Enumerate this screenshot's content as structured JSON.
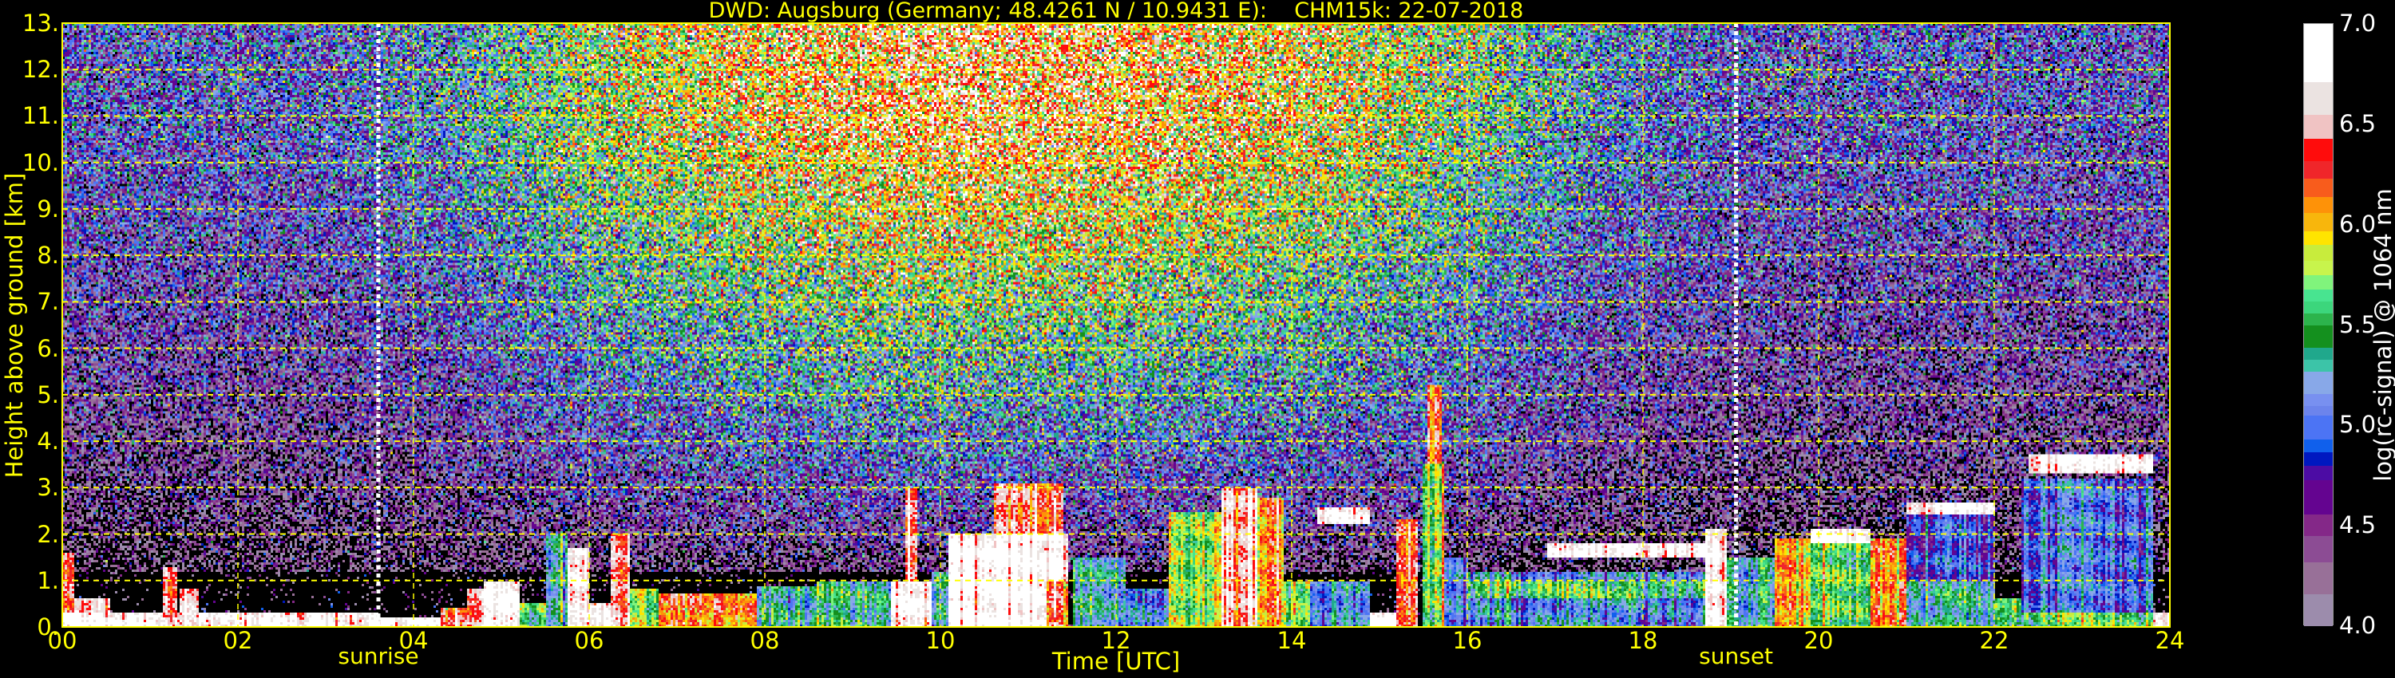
{
  "chart_data": {
    "type": "heatmap",
    "title": "DWD: Augsburg (Germany; 48.4261 N / 10.9431 E):    CHM15k: 22-07-2018",
    "xlabel": "Time [UTC]",
    "ylabel": "Height above ground [km]",
    "colorbar_label": "log(rc-signal) @ 1064 nm",
    "xlim": [
      0,
      24
    ],
    "ylim": [
      0,
      13
    ],
    "x_ticks": [
      "00",
      "02",
      "04",
      "06",
      "08",
      "10",
      "12",
      "14",
      "16",
      "18",
      "20",
      "22",
      "24"
    ],
    "x_tick_values": [
      0,
      2,
      4,
      6,
      8,
      10,
      12,
      14,
      16,
      18,
      20,
      22,
      24
    ],
    "y_ticks": [
      "0.",
      "1.",
      "2.",
      "3.",
      "4.",
      "5.",
      "6.",
      "7.",
      "8.",
      "9.",
      "10.",
      "11.",
      "12.",
      "13."
    ],
    "y_tick_values": [
      0,
      1,
      2,
      3,
      4,
      5,
      6,
      7,
      8,
      9,
      10,
      11,
      12,
      13
    ],
    "grid": true,
    "grid_color": "#ffff00",
    "clim": [
      4.0,
      7.0
    ],
    "colorbar_ticks": [
      "4.0",
      "4.5",
      "5.0",
      "5.5",
      "6.0",
      "6.5",
      "7.0"
    ],
    "colorbar_tick_values": [
      4.0,
      4.5,
      5.0,
      5.5,
      6.0,
      6.5,
      7.0
    ],
    "colormap": [
      {
        "from": 4.0,
        "to": 4.16,
        "color": "#9c8cac"
      },
      {
        "from": 4.16,
        "to": 4.32,
        "color": "#987098"
      },
      {
        "from": 4.32,
        "to": 4.45,
        "color": "#8c4c94"
      },
      {
        "from": 4.45,
        "to": 4.56,
        "color": "#842888"
      },
      {
        "from": 4.56,
        "to": 4.73,
        "color": "#640490"
      },
      {
        "from": 4.73,
        "to": 4.8,
        "color": "#4c0ca4"
      },
      {
        "from": 4.8,
        "to": 4.87,
        "color": "#0018c0"
      },
      {
        "from": 4.87,
        "to": 4.93,
        "color": "#1060ec"
      },
      {
        "from": 4.93,
        "to": 5.05,
        "color": "#4c74f4"
      },
      {
        "from": 5.05,
        "to": 5.1,
        "color": "#6c84ec"
      },
      {
        "from": 5.1,
        "to": 5.16,
        "color": "#7890f0"
      },
      {
        "from": 5.16,
        "to": 5.27,
        "color": "#88a8e8"
      },
      {
        "from": 5.27,
        "to": 5.33,
        "color": "#3cc4a8"
      },
      {
        "from": 5.33,
        "to": 5.39,
        "color": "#20a88c"
      },
      {
        "from": 5.39,
        "to": 5.5,
        "color": "#14901e"
      },
      {
        "from": 5.5,
        "to": 5.56,
        "color": "#2cb44c"
      },
      {
        "from": 5.56,
        "to": 5.62,
        "color": "#3cd67c"
      },
      {
        "from": 5.62,
        "to": 5.68,
        "color": "#48e490"
      },
      {
        "from": 5.68,
        "to": 5.75,
        "color": "#80f47c"
      },
      {
        "from": 5.75,
        "to": 5.82,
        "color": "#c8f44c"
      },
      {
        "from": 5.82,
        "to": 5.9,
        "color": "#c8ec3c"
      },
      {
        "from": 5.9,
        "to": 5.97,
        "color": "#ffe400"
      },
      {
        "from": 5.97,
        "to": 6.06,
        "color": "#f8b60c"
      },
      {
        "from": 6.06,
        "to": 6.14,
        "color": "#fe9208"
      },
      {
        "from": 6.14,
        "to": 6.23,
        "color": "#f85c1c"
      },
      {
        "from": 6.23,
        "to": 6.32,
        "color": "#f0262a"
      },
      {
        "from": 6.32,
        "to": 6.43,
        "color": "#ff0c0c"
      },
      {
        "from": 6.43,
        "to": 6.55,
        "color": "#f0c3c3"
      },
      {
        "from": 6.55,
        "to": 6.71,
        "color": "#ebe3e1"
      },
      {
        "from": 6.71,
        "to": 7.0,
        "color": "#ffffff"
      }
    ],
    "markers": [
      {
        "label": "sunrise",
        "time": 3.6
      },
      {
        "label": "sunset",
        "time": 19.06
      }
    ],
    "background_noise": {
      "hours": [
        0,
        3,
        4.5,
        6,
        8,
        10,
        12,
        14,
        16,
        17.5,
        19,
        24
      ],
      "upper_mean": [
        4.85,
        4.9,
        5.2,
        5.7,
        6.05,
        6.25,
        6.2,
        6.0,
        5.6,
        5.1,
        4.85,
        4.8
      ],
      "spread": 0.45
    },
    "features": [
      {
        "t0": 0.0,
        "t1": 3.6,
        "h0": 0.0,
        "h1": 0.3,
        "v": 6.75
      },
      {
        "t0": 0.0,
        "t1": 0.15,
        "h0": 0.3,
        "h1": 1.6,
        "v": 6.35
      },
      {
        "t0": 0.15,
        "t1": 0.55,
        "h0": 0.3,
        "h1": 0.6,
        "v": 6.6
      },
      {
        "t0": 1.15,
        "t1": 1.3,
        "h0": 0.2,
        "h1": 1.3,
        "v": 6.4
      },
      {
        "t0": 1.35,
        "t1": 1.55,
        "h0": 0.2,
        "h1": 0.8,
        "v": 6.6
      },
      {
        "t0": 3.6,
        "t1": 4.3,
        "h0": 0.0,
        "h1": 0.2,
        "v": 6.8
      },
      {
        "t0": 4.3,
        "t1": 4.6,
        "h0": 0.0,
        "h1": 0.4,
        "v": 6.4
      },
      {
        "t0": 4.6,
        "t1": 4.8,
        "h0": 0.0,
        "h1": 0.8,
        "v": 6.4
      },
      {
        "t0": 4.8,
        "t1": 5.2,
        "h0": 0.0,
        "h1": 1.0,
        "v": 6.9
      },
      {
        "t0": 5.2,
        "t1": 5.5,
        "h0": 0.0,
        "h1": 0.5,
        "v": 5.6
      },
      {
        "t0": 5.5,
        "t1": 5.75,
        "h0": 0.0,
        "h1": 2.0,
        "v": 5.3
      },
      {
        "t0": 5.75,
        "t1": 6.0,
        "h0": 0.0,
        "h1": 1.7,
        "v": 6.7
      },
      {
        "t0": 6.0,
        "t1": 6.25,
        "h0": 0.0,
        "h1": 0.5,
        "v": 6.8
      },
      {
        "t0": 6.25,
        "t1": 6.45,
        "h0": 0.0,
        "h1": 2.0,
        "v": 6.6
      },
      {
        "t0": 6.45,
        "t1": 6.8,
        "h0": 0.0,
        "h1": 0.8,
        "v": 5.65
      },
      {
        "t0": 6.8,
        "t1": 7.9,
        "h0": 0.0,
        "h1": 0.7,
        "v": 6.2
      },
      {
        "t0": 7.9,
        "t1": 8.6,
        "h0": 0.0,
        "h1": 0.9,
        "v": 5.3
      },
      {
        "t0": 8.6,
        "t1": 9.45,
        "h0": 0.0,
        "h1": 1.0,
        "v": 5.4
      },
      {
        "t0": 9.45,
        "t1": 9.9,
        "h0": 0.0,
        "h1": 1.0,
        "v": 6.9
      },
      {
        "t0": 9.6,
        "t1": 9.75,
        "h0": 1.0,
        "h1": 3.0,
        "v": 6.5
      },
      {
        "t0": 9.9,
        "t1": 10.1,
        "h0": 0.0,
        "h1": 1.2,
        "v": 5.2
      },
      {
        "t0": 10.1,
        "t1": 11.45,
        "h0": 0.0,
        "h1": 2.0,
        "v": 6.85
      },
      {
        "t0": 10.6,
        "t1": 11.4,
        "h0": 2.0,
        "h1": 3.1,
        "v": 6.3
      },
      {
        "t0": 11.2,
        "t1": 11.45,
        "h0": 0.0,
        "h1": 1.0,
        "v": 6.35
      },
      {
        "t0": 11.5,
        "t1": 12.1,
        "h0": 0.0,
        "h1": 1.5,
        "v": 5.3
      },
      {
        "t0": 12.1,
        "t1": 12.6,
        "h0": 0.0,
        "h1": 0.8,
        "v": 5.1
      },
      {
        "t0": 12.6,
        "t1": 13.2,
        "h0": 0.0,
        "h1": 2.5,
        "v": 5.75
      },
      {
        "t0": 13.2,
        "t1": 13.6,
        "h0": 0.0,
        "h1": 3.0,
        "v": 6.5
      },
      {
        "t0": 13.6,
        "t1": 13.9,
        "h0": 0.0,
        "h1": 2.8,
        "v": 6.1
      },
      {
        "t0": 13.9,
        "t1": 14.2,
        "h0": 0.0,
        "h1": 1.0,
        "v": 5.6
      },
      {
        "t0": 14.2,
        "t1": 14.9,
        "h0": 0.0,
        "h1": 1.0,
        "v": 5.15
      },
      {
        "t0": 14.3,
        "t1": 14.9,
        "h0": 2.2,
        "h1": 2.6,
        "v": 6.8
      },
      {
        "t0": 14.9,
        "t1": 15.2,
        "h0": 0.0,
        "h1": 0.3,
        "v": 6.9
      },
      {
        "t0": 15.2,
        "t1": 15.45,
        "h0": 0.0,
        "h1": 2.3,
        "v": 6.35
      },
      {
        "t0": 15.5,
        "t1": 15.75,
        "h0": 0.0,
        "h1": 3.5,
        "v": 5.7
      },
      {
        "t0": 15.55,
        "t1": 15.7,
        "h0": 3.5,
        "h1": 5.2,
        "v": 6.3
      },
      {
        "t0": 15.75,
        "t1": 16.0,
        "h0": 0.0,
        "h1": 1.5,
        "v": 5.15
      },
      {
        "t0": 16.0,
        "t1": 18.7,
        "h0": 0.0,
        "h1": 1.2,
        "v": 5.1
      },
      {
        "t0": 16.0,
        "t1": 18.7,
        "h0": 0.6,
        "h1": 1.0,
        "v": 5.55
      },
      {
        "t0": 16.9,
        "t1": 18.7,
        "h0": 1.5,
        "h1": 1.8,
        "v": 6.8
      },
      {
        "t0": 18.7,
        "t1": 18.95,
        "h0": 0.0,
        "h1": 2.1,
        "v": 6.7
      },
      {
        "t0": 18.95,
        "t1": 19.5,
        "h0": 0.0,
        "h1": 1.5,
        "v": 5.35
      },
      {
        "t0": 19.5,
        "t1": 19.9,
        "h0": 0.0,
        "h1": 1.9,
        "v": 6.15
      },
      {
        "t0": 19.9,
        "t1": 20.6,
        "h0": 0.0,
        "h1": 1.8,
        "v": 5.55
      },
      {
        "t0": 19.9,
        "t1": 20.6,
        "h0": 1.8,
        "h1": 2.1,
        "v": 6.8
      },
      {
        "t0": 20.6,
        "t1": 21.0,
        "h0": 0.0,
        "h1": 1.9,
        "v": 6.15
      },
      {
        "t0": 21.0,
        "t1": 22.0,
        "h0": 0.0,
        "h1": 1.0,
        "v": 5.3
      },
      {
        "t0": 21.0,
        "t1": 22.0,
        "h0": 1.0,
        "h1": 2.4,
        "v": 4.85
      },
      {
        "t0": 21.0,
        "t1": 22.0,
        "h0": 2.4,
        "h1": 2.7,
        "v": 6.8
      },
      {
        "t0": 22.0,
        "t1": 22.3,
        "h0": 0.0,
        "h1": 0.6,
        "v": 5.5
      },
      {
        "t0": 22.3,
        "t1": 23.8,
        "h0": 0.3,
        "h1": 3.2,
        "v": 5.0
      },
      {
        "t0": 22.4,
        "t1": 23.8,
        "h0": 3.3,
        "h1": 3.7,
        "v": 6.8
      },
      {
        "t0": 22.3,
        "t1": 24.0,
        "h0": 0.0,
        "h1": 0.3,
        "v": 5.6
      },
      {
        "t0": 23.8,
        "t1": 24.0,
        "h0": 0.0,
        "h1": 0.3,
        "v": 6.8
      }
    ]
  }
}
